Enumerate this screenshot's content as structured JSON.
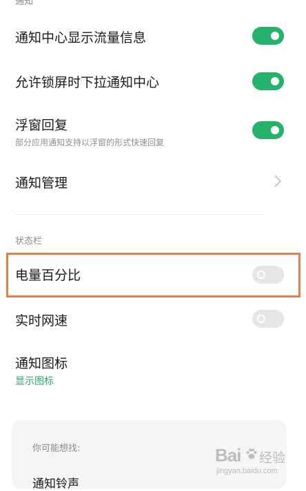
{
  "notifications_section": {
    "header": "通知",
    "items": [
      {
        "title": "通知中心显示流量信息",
        "toggle_on": true
      },
      {
        "title": "允许锁屏时下拉通知中心",
        "toggle_on": true
      },
      {
        "title": "浮窗回复",
        "subtitle": "部分应用通知支持以浮窗的形式快速回复",
        "toggle_on": true
      },
      {
        "title": "通知管理"
      }
    ]
  },
  "status_bar_section": {
    "header": "状态栏",
    "items": [
      {
        "title": "电量百分比",
        "toggle_on": false,
        "highlighted": true
      },
      {
        "title": "实时网速",
        "toggle_on": false
      },
      {
        "title": "通知图标",
        "link": "显示图标"
      }
    ]
  },
  "suggestions": {
    "title": "你可能想找:",
    "items": [
      "通知铃声"
    ]
  },
  "watermark": {
    "logo": "Bai",
    "logo_cn": "经验",
    "url": "jingyan.baidu.com"
  },
  "colors": {
    "toggle_on": "#25b26a",
    "toggle_off": "#e6e6e6",
    "highlight_border": "#f07a45",
    "link_green": "#2ea56b"
  },
  "icons": {
    "chevron": "chevron-right-icon",
    "paw": "paw-icon"
  }
}
